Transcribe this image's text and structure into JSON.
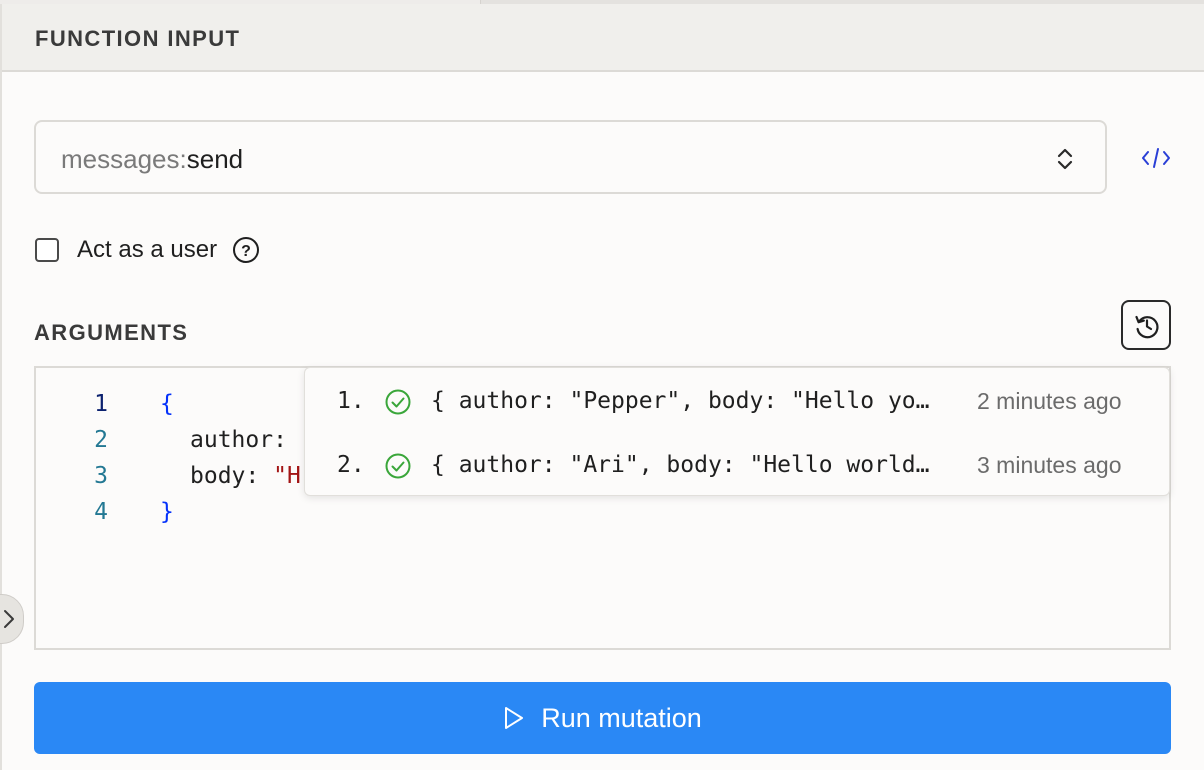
{
  "header": {
    "title": "FUNCTION INPUT"
  },
  "function_select": {
    "module": "messages:",
    "name": "send"
  },
  "act_as_user": {
    "label": "Act as a user",
    "checked": false
  },
  "arguments": {
    "title": "ARGUMENTS",
    "lines": [
      {
        "number": "1",
        "text": "{"
      },
      {
        "number": "2",
        "key": "author: "
      },
      {
        "number": "3",
        "key": "body: ",
        "value": "\"H"
      },
      {
        "number": "4",
        "text": "}"
      }
    ]
  },
  "history": {
    "items": [
      {
        "index": "1.",
        "args": "{ author: \"Pepper\", body: \"Hello yo…",
        "time": "2 minutes ago",
        "status": "success"
      },
      {
        "index": "2.",
        "args": "{ author: \"Ari\", body: \"Hello world…",
        "time": "3 minutes ago",
        "status": "success"
      }
    ]
  },
  "run_button": {
    "label": "Run mutation"
  },
  "icons": {
    "select": "chevron-up-down-icon",
    "code": "code-icon",
    "help": "question-circle-icon",
    "history": "history-icon",
    "status": "check-circle-icon",
    "run": "play-icon",
    "collapse": "chevron-right-icon"
  },
  "colors": {
    "primary": "#2a88f5",
    "success": "#3aa63a",
    "code_link": "#2a3fd6"
  }
}
